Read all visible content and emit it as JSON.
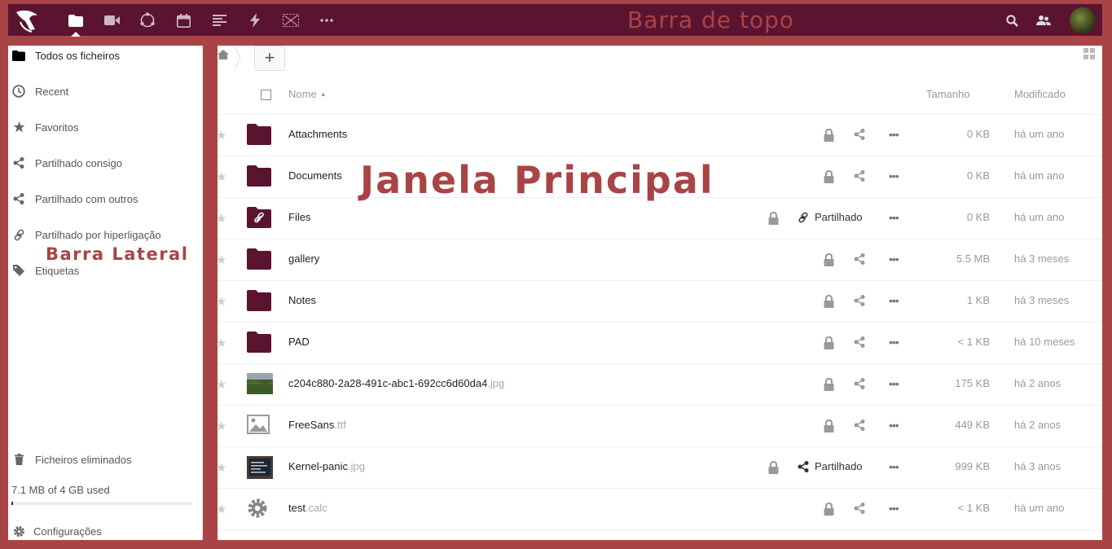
{
  "overlay": {
    "topbar_label": "Barra de topo",
    "sidebar_label": "Barra Lateral",
    "main_label": "Janela Principal"
  },
  "topbar": {
    "apps": [
      "files-icon",
      "video-icon",
      "circles-icon",
      "calendar-icon",
      "notes-icon",
      "activity-icon",
      "gallery-icon",
      "more-apps-icon"
    ],
    "right": [
      "search-icon",
      "contacts-icon",
      "avatar"
    ],
    "colors": {
      "background": "#5b1430",
      "frame": "#a94446"
    }
  },
  "sidebar": {
    "items": [
      {
        "label": "Todos os ficheiros",
        "icon": "folder-icon",
        "active": true
      },
      {
        "label": "Recent",
        "icon": "clock-icon"
      },
      {
        "label": "Favoritos",
        "icon": "star-icon"
      },
      {
        "label": "Partilhado consigo",
        "icon": "share-icon"
      },
      {
        "label": "Partilhado com outros",
        "icon": "share-icon"
      },
      {
        "label": "Partilhado por hiperligação",
        "icon": "link-icon"
      },
      {
        "label": "Etiquetas",
        "icon": "tag-icon"
      }
    ],
    "trash_label": "Ficheiros eliminados",
    "quota_text": "7.1 MB of 4 GB used",
    "quota_fraction": 0.002,
    "settings_label": "Configurações"
  },
  "main": {
    "new_button": "+",
    "columns": {
      "name": "Nome",
      "size": "Tamanho",
      "modified": "Modificado"
    },
    "files": [
      {
        "name": "Attachments",
        "ext": "",
        "type": "folder",
        "shared": false,
        "size": "0 KB",
        "modified": "há um ano"
      },
      {
        "name": "Documents",
        "ext": "",
        "type": "folder",
        "shared": false,
        "size": "0 KB",
        "modified": "há um ano"
      },
      {
        "name": "Files",
        "ext": "",
        "type": "folder-link",
        "shared": true,
        "shared_label": "Partilhado",
        "shared_icon": "link-icon",
        "size": "0 KB",
        "modified": "há um ano"
      },
      {
        "name": "gallery",
        "ext": "",
        "type": "folder",
        "shared": false,
        "size": "5.5 MB",
        "modified": "há 3 meses"
      },
      {
        "name": "Notes",
        "ext": "",
        "type": "folder",
        "shared": false,
        "size": "1 KB",
        "modified": "há 3 meses"
      },
      {
        "name": "PAD",
        "ext": "",
        "type": "folder",
        "shared": false,
        "size": "< 1 KB",
        "modified": "há 10 meses"
      },
      {
        "name": "c204c880-2a28-491c-abc1-692cc6d60da4",
        "ext": ".jpg",
        "type": "photo-landscape",
        "shared": false,
        "size": "175 KB",
        "modified": "há 2 anos"
      },
      {
        "name": "FreeSans",
        "ext": ".ttf",
        "type": "image-generic",
        "shared": false,
        "size": "449 KB",
        "modified": "há 2 anos"
      },
      {
        "name": "Kernel-panic",
        "ext": ".jpg",
        "type": "photo-screen",
        "shared": true,
        "shared_label": "Partilhado",
        "shared_icon": "share-icon",
        "size": "999 KB",
        "modified": "há 3 anos"
      },
      {
        "name": "test",
        "ext": ".calc",
        "type": "gear",
        "shared": false,
        "size": "< 1 KB",
        "modified": "há um ano"
      }
    ]
  }
}
